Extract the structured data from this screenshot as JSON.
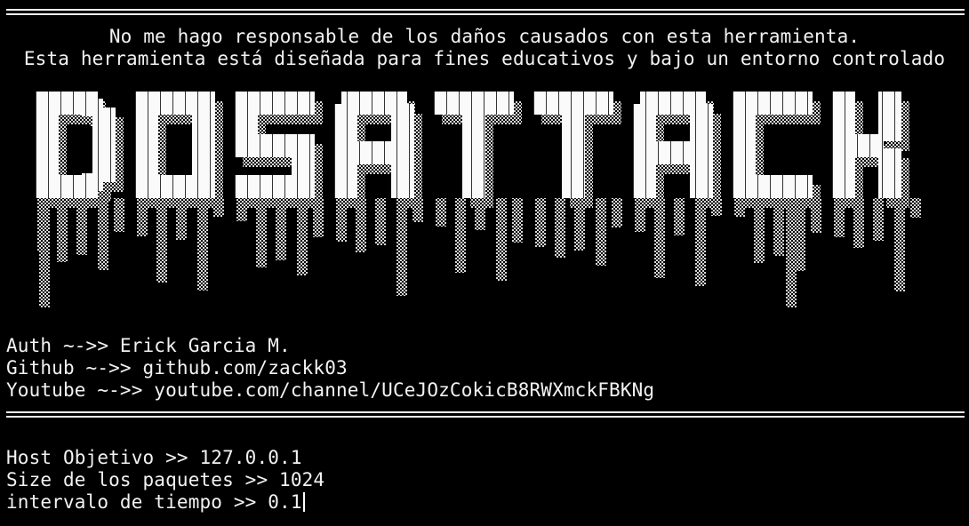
{
  "disclaimer": {
    "line1": "No me hago responsable de los daños causados con esta herramienta.",
    "line2": "Esta herramienta está diseñada para fines educativos y bajo un entorno controlado"
  },
  "banner": {
    "text": "DOSATTACK"
  },
  "credits": {
    "auth": "Auth ~->> Erick Garcia M.",
    "github": "Github ~->> github.com/zackk03",
    "youtube": "Youtube ~->> youtube.com/channel/UCeJOzCokicB8RWXmckFBKNg"
  },
  "prompts": {
    "host": "Host Objetivo >> 127.0.0.1",
    "size": "Size de los paquetes >> 1024",
    "interval": "intervalo de tiempo >> 0.1"
  },
  "colors": {
    "background": "#000000",
    "foreground": "#f2f2f2"
  }
}
